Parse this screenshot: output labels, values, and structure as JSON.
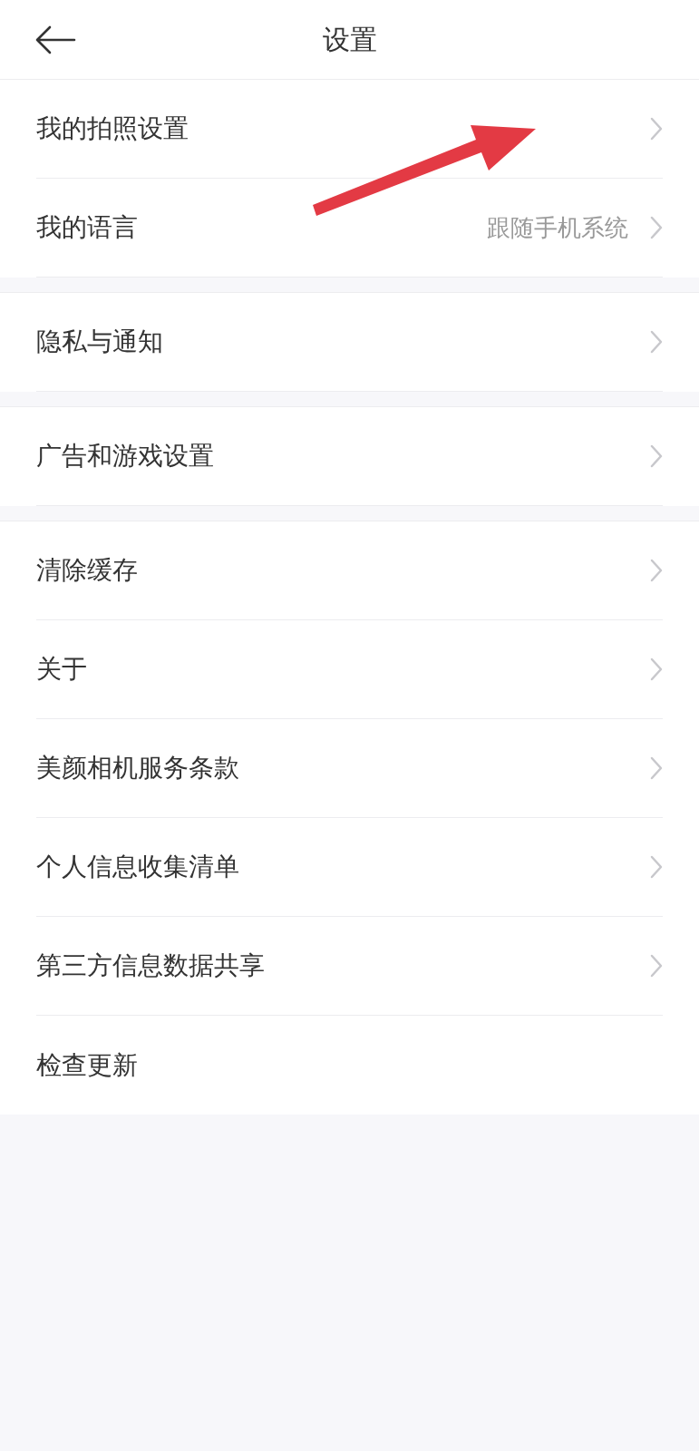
{
  "header": {
    "title": "设置"
  },
  "groups": [
    {
      "items": [
        {
          "label": "我的拍照设置",
          "kind": "link"
        },
        {
          "label": "我的语言",
          "value": "跟随手机系统",
          "kind": "link"
        }
      ]
    },
    {
      "items": [
        {
          "label": "隐私与通知",
          "kind": "link"
        }
      ]
    },
    {
      "items": [
        {
          "label": "广告和游戏设置",
          "kind": "link"
        }
      ]
    },
    {
      "items": [
        {
          "label": "清除缓存",
          "kind": "link"
        },
        {
          "label": "关于",
          "kind": "link"
        },
        {
          "label": "美颜相机服务条款",
          "kind": "link"
        },
        {
          "label": "个人信息收集清单",
          "kind": "link"
        },
        {
          "label": "第三方信息数据共享",
          "kind": "link"
        },
        {
          "label": "检查更新",
          "kind": "plain"
        }
      ]
    }
  ]
}
